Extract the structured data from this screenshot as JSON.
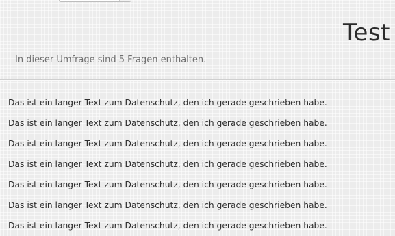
{
  "survey": {
    "title": "Test",
    "description": "In dieser Umfrage sind 5 Fragen enthalten."
  },
  "privacy": {
    "lines": [
      "Das ist ein langer Text zum Datenschutz, den ich gerade geschrieben habe.",
      "Das ist ein langer Text zum Datenschutz, den ich gerade geschrieben habe.",
      "Das ist ein langer Text zum Datenschutz, den ich gerade geschrieben habe.",
      "Das ist ein langer Text zum Datenschutz, den ich gerade geschrieben habe.",
      "Das ist ein langer Text zum Datenschutz, den ich gerade geschrieben habe.",
      "Das ist ein langer Text zum Datenschutz, den ich gerade geschrieben habe.",
      "Das ist ein langer Text zum Datenschutz, den ich gerade geschrieben habe."
    ]
  }
}
